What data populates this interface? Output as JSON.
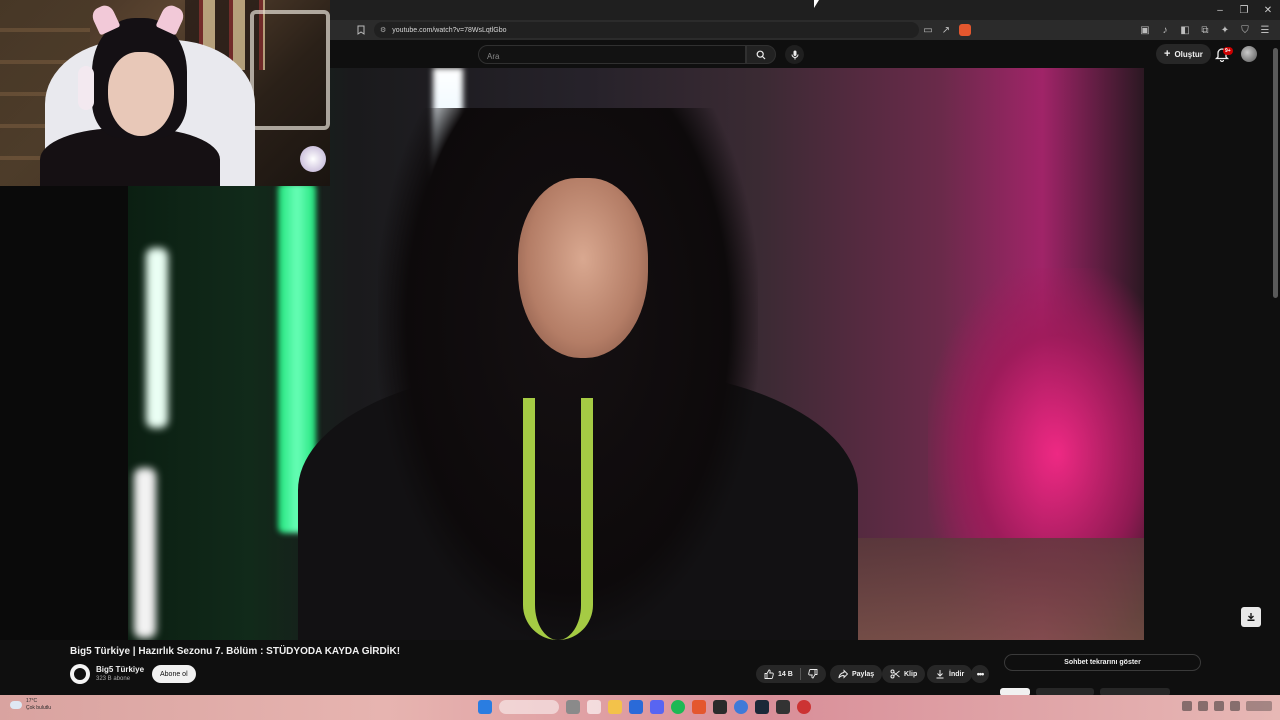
{
  "browser": {
    "url": "youtube.com/watch?v=78WsLqtlGbo"
  },
  "header": {
    "search_placeholder": "Ara",
    "create_label": "Oluştur",
    "notification_count": "9+"
  },
  "video": {
    "title": "Big5 Türkiye | Hazırlık Sezonu 7. Bölüm : STÜDYODA KAYDA GİRDİK!",
    "channel_name": "Big5 Türkiye",
    "channel_subs": "323 B abone",
    "subscribe_label": "Abone ol",
    "like_count": "14 B",
    "share_label": "Paylaş",
    "clip_label": "Klip",
    "download_label": "İndir"
  },
  "sidebar": {
    "chat_toggle_label": "Sohbet tekrarını göster"
  },
  "taskbar": {
    "temperature": "17°C",
    "weather_desc": "Çok bulutlu"
  },
  "colors": {
    "background": "#0f0f0f",
    "pill": "#272727",
    "accent_red": "#cc0000"
  }
}
